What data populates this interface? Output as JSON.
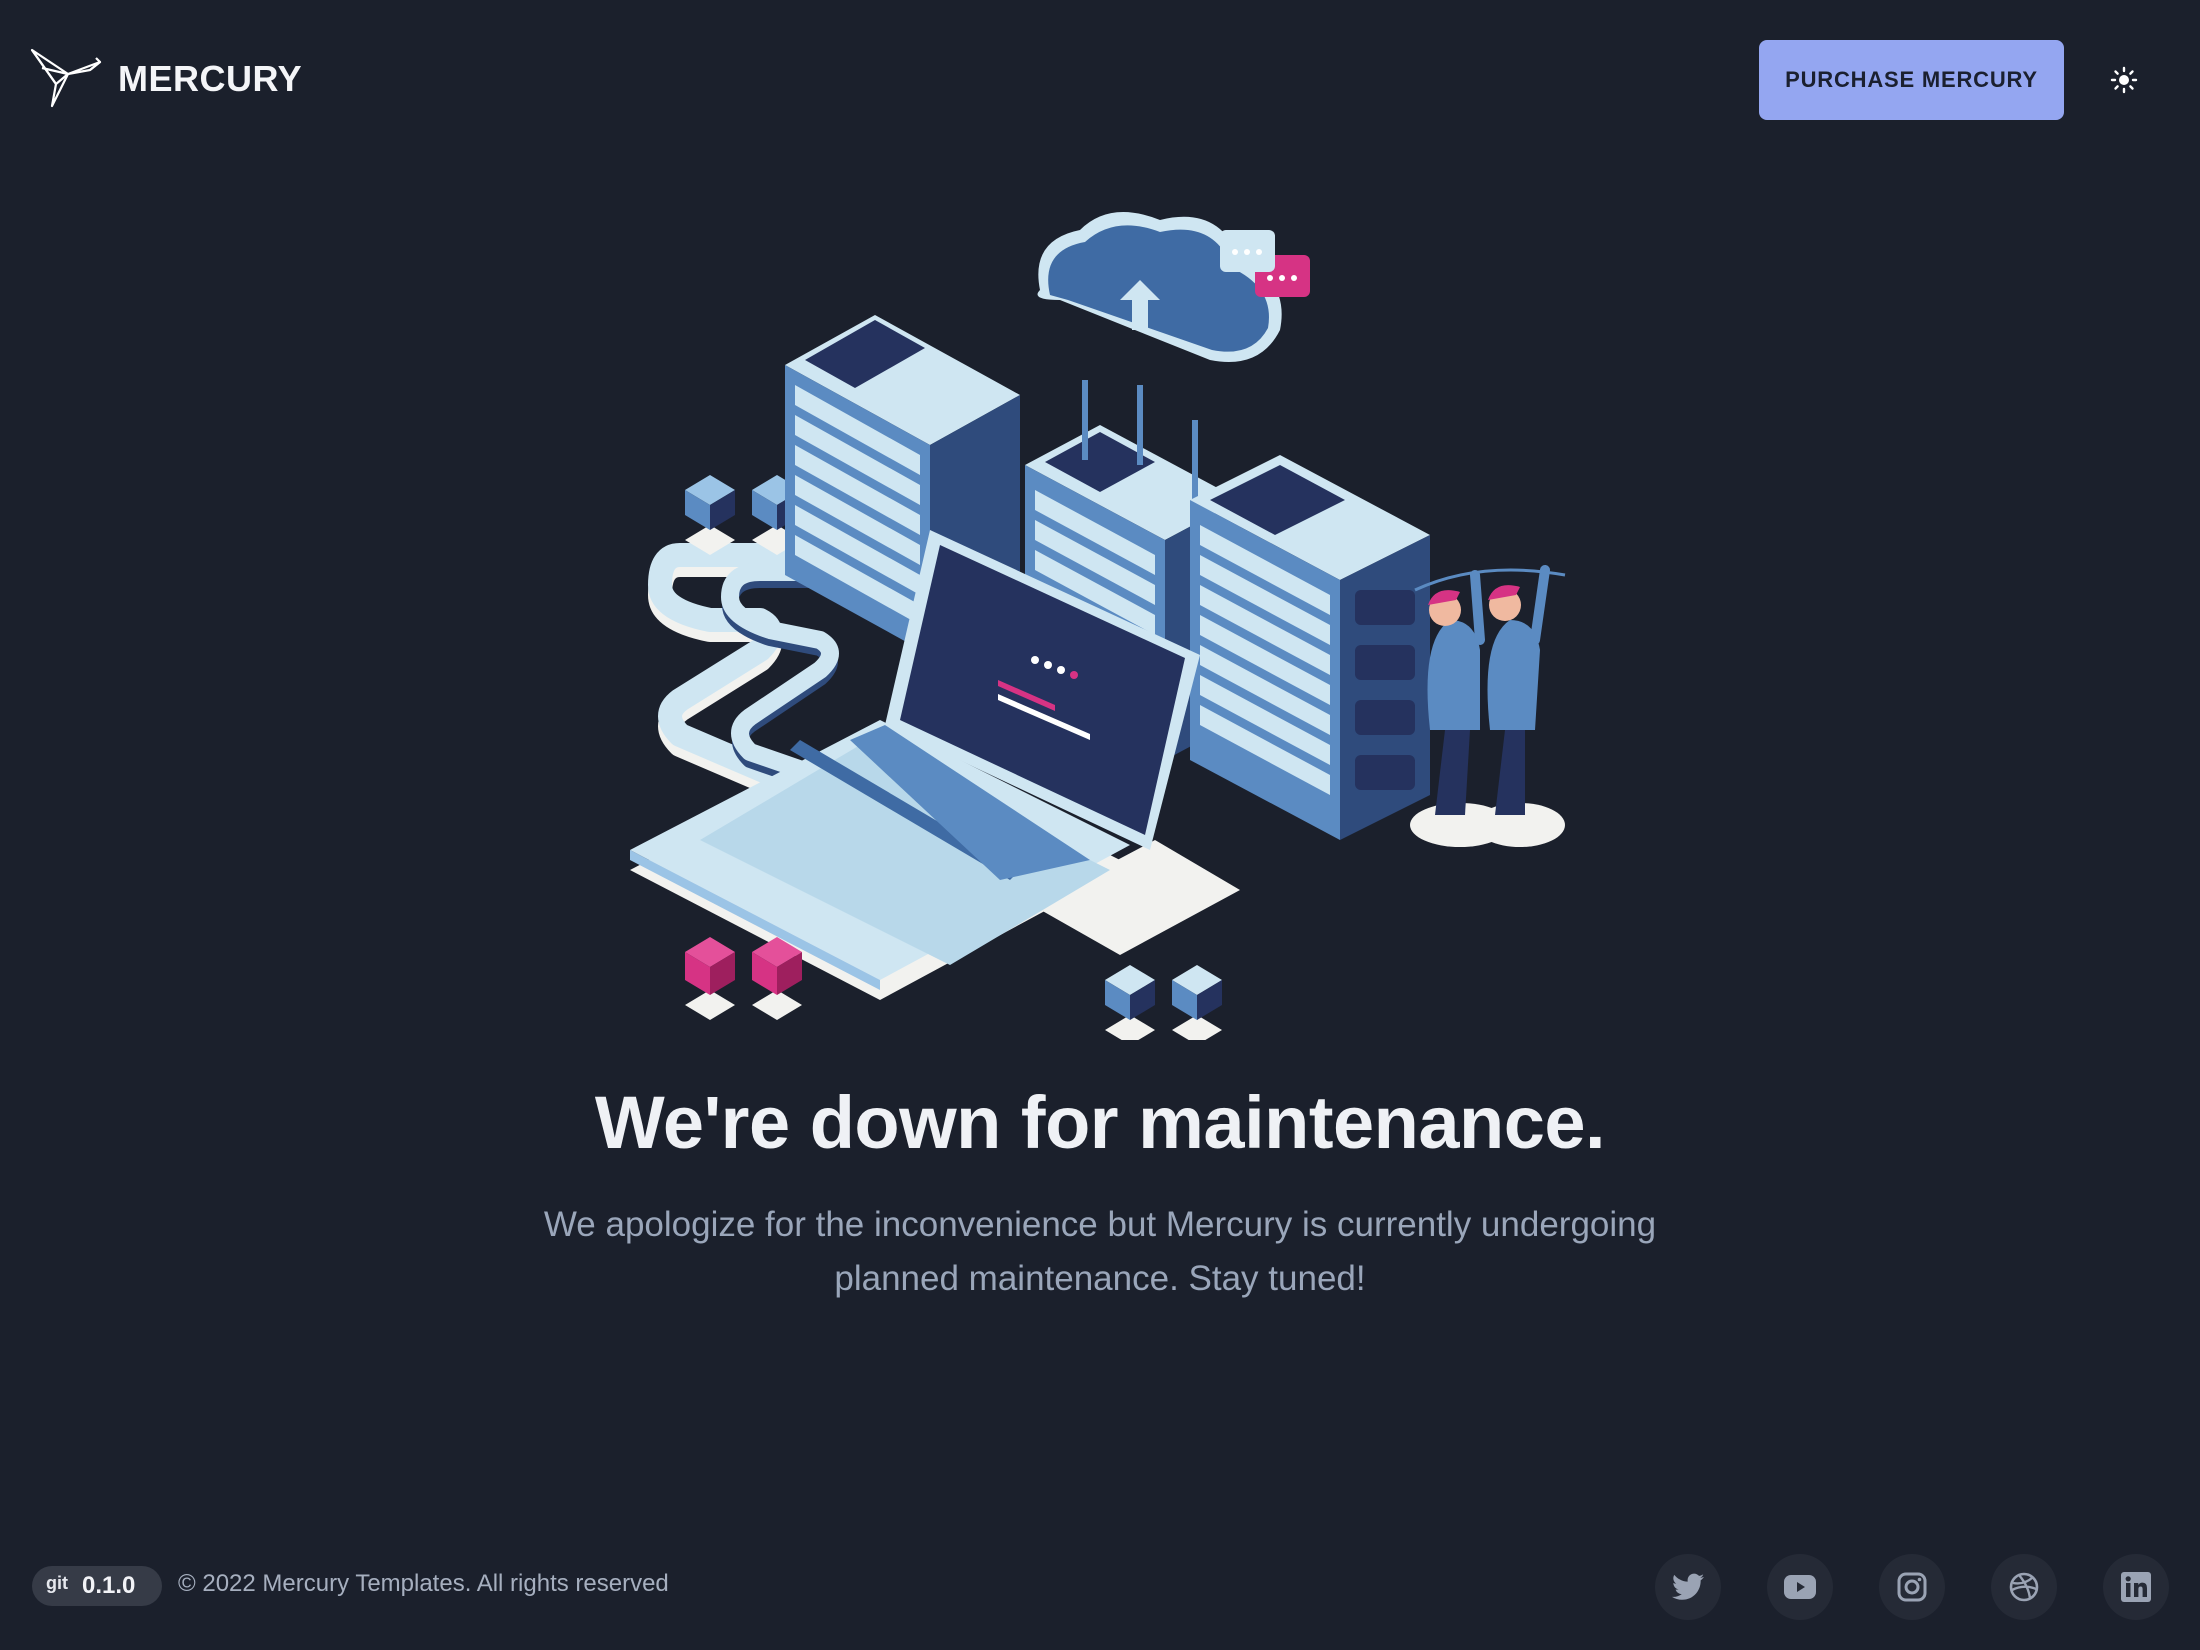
{
  "header": {
    "brand_name": "MERCURY",
    "purchase_label": "PURCHASE MERCURY",
    "theme_toggle_icon": "sun-icon"
  },
  "main": {
    "illustration": "server-maintenance-illustration",
    "headline": "We're down for maintenance.",
    "subtitle": "We apologize for the inconvenience but Mercury is currently undergoing planned maintenance. Stay tuned!"
  },
  "footer": {
    "git_label": "git",
    "version": "0.1.0",
    "copyright": "© 2022 Mercury Templates. All rights reserved",
    "socials": [
      "twitter-icon",
      "youtube-icon",
      "instagram-icon",
      "dribbble-icon",
      "linkedin-icon"
    ]
  },
  "colors": {
    "background": "#1b202c",
    "accent": "#94a6f1",
    "pink": "#d63384",
    "server_light": "#cfe6f2",
    "server_mid": "#5b8bc2",
    "server_dark": "#25325e"
  }
}
